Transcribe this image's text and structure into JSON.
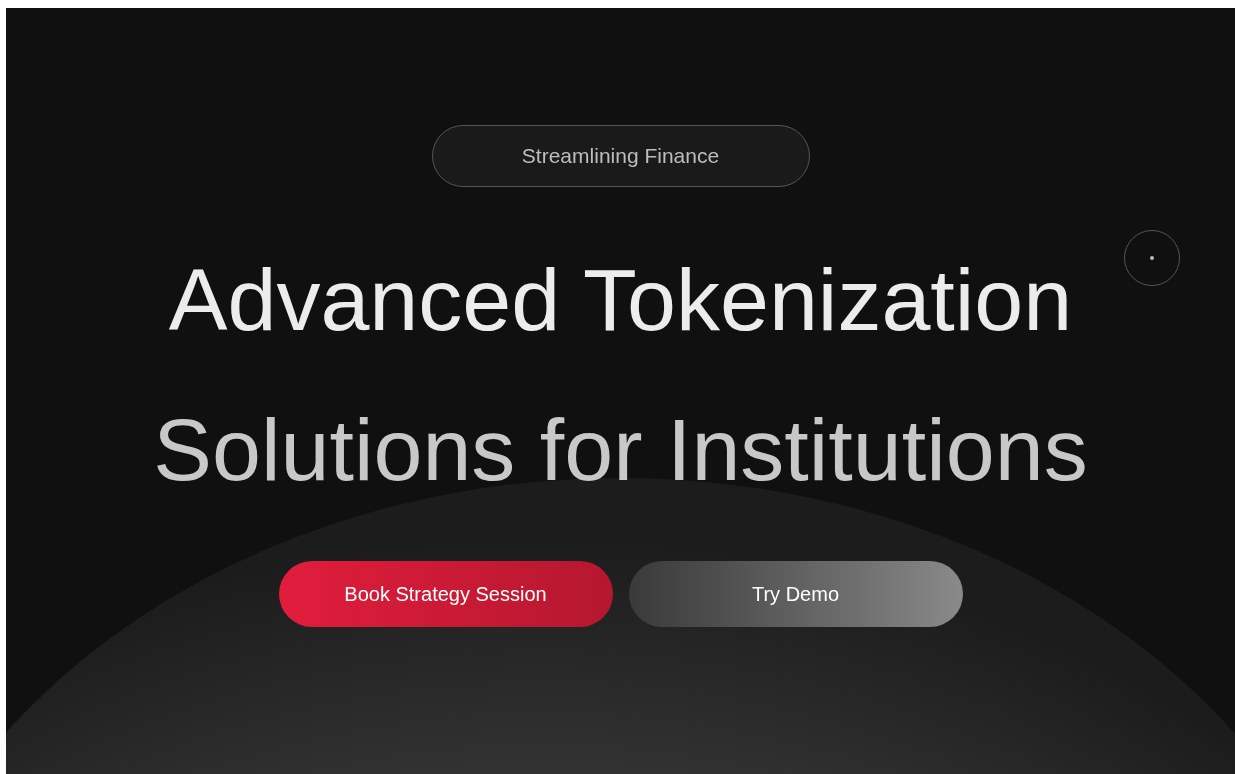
{
  "hero": {
    "badge": "Streamlining Finance",
    "headline": [
      "Advanced Tokenization",
      "Solutions for Institutions"
    ],
    "buttons": [
      {
        "label": "Book Strategy Session",
        "kind": "primary"
      },
      {
        "label": "Try Demo",
        "kind": "secondary"
      }
    ]
  }
}
